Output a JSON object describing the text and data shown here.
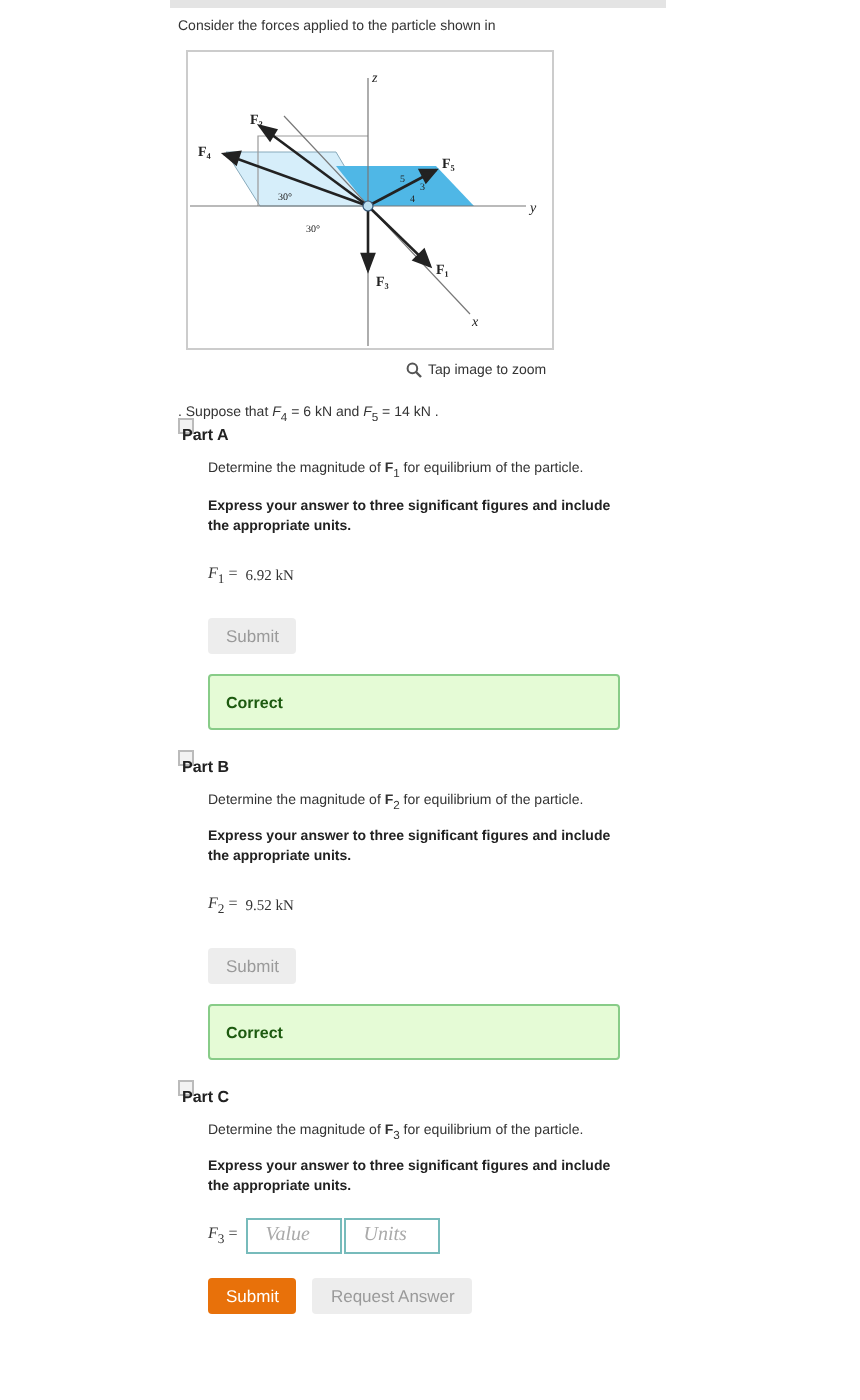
{
  "intro": "Consider the forces applied to the particle shown in",
  "figure": {
    "labels": [
      {
        "text": "z"
      },
      {
        "text": "y"
      },
      {
        "text": "x"
      },
      {
        "text": "F₂"
      },
      {
        "text": "F₄"
      },
      {
        "text": "F₅"
      },
      {
        "text": "F₃"
      },
      {
        "text": "F₁"
      },
      {
        "text": "30°"
      },
      {
        "text": "30°"
      },
      {
        "text": "5"
      },
      {
        "text": "3"
      },
      {
        "text": "4"
      }
    ]
  },
  "zoom_caption": "Tap image to zoom",
  "given": ". Suppose that *F*$_{4}$ = 6  kN and *F*$_{5}$ = 14  kN .",
  "parts": [
    {
      "title": "Part A",
      "question": "Determine the magnitude of **F**$_{1}$ for equilibrium of the particle.",
      "instruction": "Express your answer to three significant figures and include the appropriate units.",
      "kind": "answered",
      "answer_label": "*F*$_{1}$ =",
      "answer": "6.92 kN",
      "buttons": [
        {
          "label": "Submit",
          "disabled": true
        }
      ],
      "feedback": "Correct"
    },
    {
      "title": "Part B",
      "question": "Determine the magnitude of **F**$_{2}$ for equilibrium of the particle.",
      "instruction": "Express your answer to three significant figures and include the appropriate units.",
      "kind": "answered",
      "answer_label": "*F*$_{2}$ =",
      "answer": "9.52 kN",
      "buttons": [
        {
          "label": "Submit",
          "disabled": true
        }
      ],
      "feedback": "Correct"
    },
    {
      "title": "Part C",
      "question": "Determine the magnitude of **F**$_{3}$ for equilibrium of the particle.",
      "instruction": "Express your answer to three significant figures and include the appropriate units.",
      "kind": "input",
      "answer_label": "*F*$_{3}$ =",
      "value_placeholder": "Value",
      "units_placeholder": "Units",
      "buttons": [
        {
          "label": "Submit",
          "disabled": false
        },
        {
          "label": "Request Answer",
          "disabled": true
        }
      ]
    }
  ]
}
